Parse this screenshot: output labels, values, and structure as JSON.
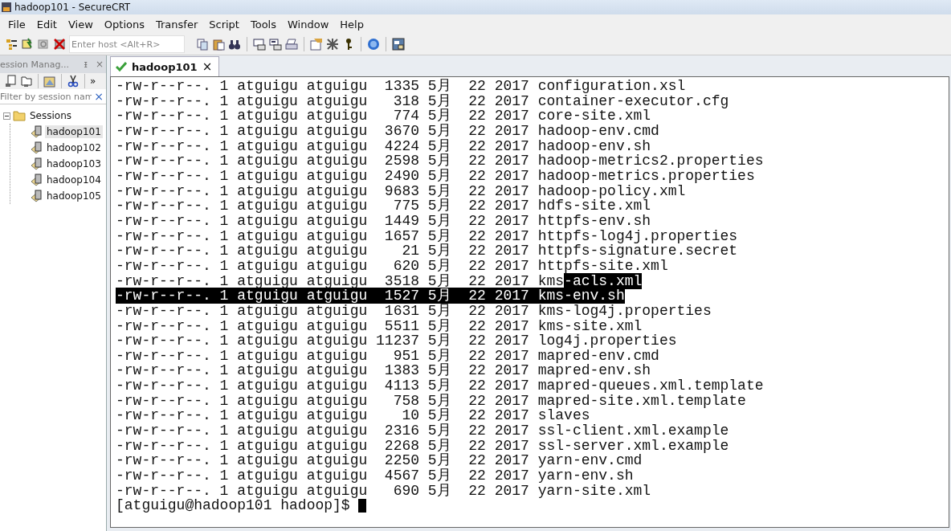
{
  "window": {
    "title": "hadoop101 - SecureCRT"
  },
  "menu": [
    "File",
    "Edit",
    "View",
    "Options",
    "Transfer",
    "Script",
    "Tools",
    "Window",
    "Help"
  ],
  "toolbar": {
    "host_placeholder": "Enter host <Alt+R>"
  },
  "session_manager": {
    "title": "ession Manag...",
    "pin": "ᵻ",
    "close": "×",
    "more": "»",
    "filter_placeholder": "Filter by session nam",
    "filter_clear": "×",
    "tree": [
      {
        "label": "Sessions",
        "expanded": true,
        "children": [
          {
            "label": "hadoop101",
            "selected": true
          },
          {
            "label": "hadoop102",
            "selected": false
          },
          {
            "label": "hadoop103",
            "selected": false
          },
          {
            "label": "hadoop104",
            "selected": false
          },
          {
            "label": "hadoop105",
            "selected": false
          }
        ]
      }
    ]
  },
  "tabs": [
    {
      "label": "hadoop101",
      "connected": true,
      "selected": true,
      "close": "×"
    }
  ],
  "terminal": {
    "lines": [
      {
        "text": "-rw-r--r--. 1 atguigu atguigu  1335 5月  22 2017 configuration.xsl",
        "selected": false
      },
      {
        "text": "-rw-r--r--. 1 atguigu atguigu   318 5月  22 2017 container-executor.cfg",
        "selected": false
      },
      {
        "text": "-rw-r--r--. 1 atguigu atguigu   774 5月  22 2017 core-site.xml",
        "selected": false
      },
      {
        "text": "-rw-r--r--. 1 atguigu atguigu  3670 5月  22 2017 hadoop-env.cmd",
        "selected": false
      },
      {
        "text": "-rw-r--r--. 1 atguigu atguigu  4224 5月  22 2017 hadoop-env.sh",
        "selected": false
      },
      {
        "text": "-rw-r--r--. 1 atguigu atguigu  2598 5月  22 2017 hadoop-metrics2.properties",
        "selected": false
      },
      {
        "text": "-rw-r--r--. 1 atguigu atguigu  2490 5月  22 2017 hadoop-metrics.properties",
        "selected": false
      },
      {
        "text": "-rw-r--r--. 1 atguigu atguigu  9683 5月  22 2017 hadoop-policy.xml",
        "selected": false
      },
      {
        "text": "-rw-r--r--. 1 atguigu atguigu   775 5月  22 2017 hdfs-site.xml",
        "selected": false
      },
      {
        "text": "-rw-r--r--. 1 atguigu atguigu  1449 5月  22 2017 httpfs-env.sh",
        "selected": false
      },
      {
        "text": "-rw-r--r--. 1 atguigu atguigu  1657 5月  22 2017 httpfs-log4j.properties",
        "selected": false
      },
      {
        "text": "-rw-r--r--. 1 atguigu atguigu    21 5月  22 2017 httpfs-signature.secret",
        "selected": false
      },
      {
        "text": "-rw-r--r--. 1 atguigu atguigu   620 5月  22 2017 httpfs-site.xml",
        "selected": false
      },
      {
        "text": "-rw-r--r--. 1 atguigu atguigu  3518 5月  22 2017 kms",
        "selected": false,
        "selected_tail": "-acls.xml"
      },
      {
        "text": "-rw-r--r--. 1 atguigu atguigu  1527 5月  22 2017 kms-env.sh",
        "selected": true
      },
      {
        "text": "-rw-r--r--. 1 atguigu atguigu  1631 5月  22 2017 kms-log4j.properties",
        "selected": false
      },
      {
        "text": "-rw-r--r--. 1 atguigu atguigu  5511 5月  22 2017 kms-site.xml",
        "selected": false
      },
      {
        "text": "-rw-r--r--. 1 atguigu atguigu 11237 5月  22 2017 log4j.properties",
        "selected": false
      },
      {
        "text": "-rw-r--r--. 1 atguigu atguigu   951 5月  22 2017 mapred-env.cmd",
        "selected": false
      },
      {
        "text": "-rw-r--r--. 1 atguigu atguigu  1383 5月  22 2017 mapred-env.sh",
        "selected": false
      },
      {
        "text": "-rw-r--r--. 1 atguigu atguigu  4113 5月  22 2017 mapred-queues.xml.template",
        "selected": false
      },
      {
        "text": "-rw-r--r--. 1 atguigu atguigu   758 5月  22 2017 mapred-site.xml.template",
        "selected": false
      },
      {
        "text": "-rw-r--r--. 1 atguigu atguigu    10 5月  22 2017 slaves",
        "selected": false
      },
      {
        "text": "-rw-r--r--. 1 atguigu atguigu  2316 5月  22 2017 ssl-client.xml.example",
        "selected": false
      },
      {
        "text": "-rw-r--r--. 1 atguigu atguigu  2268 5月  22 2017 ssl-server.xml.example",
        "selected": false
      },
      {
        "text": "-rw-r--r--. 1 atguigu atguigu  2250 5月  22 2017 yarn-env.cmd",
        "selected": false
      },
      {
        "text": "-rw-r--r--. 1 atguigu atguigu  4567 5月  22 2017 yarn-env.sh",
        "selected": false
      },
      {
        "text": "-rw-r--r--. 1 atguigu atguigu   690 5月  22 2017 yarn-site.xml",
        "selected": false
      }
    ],
    "prompt": "[atguigu@hadoop101 hadoop]$ "
  }
}
